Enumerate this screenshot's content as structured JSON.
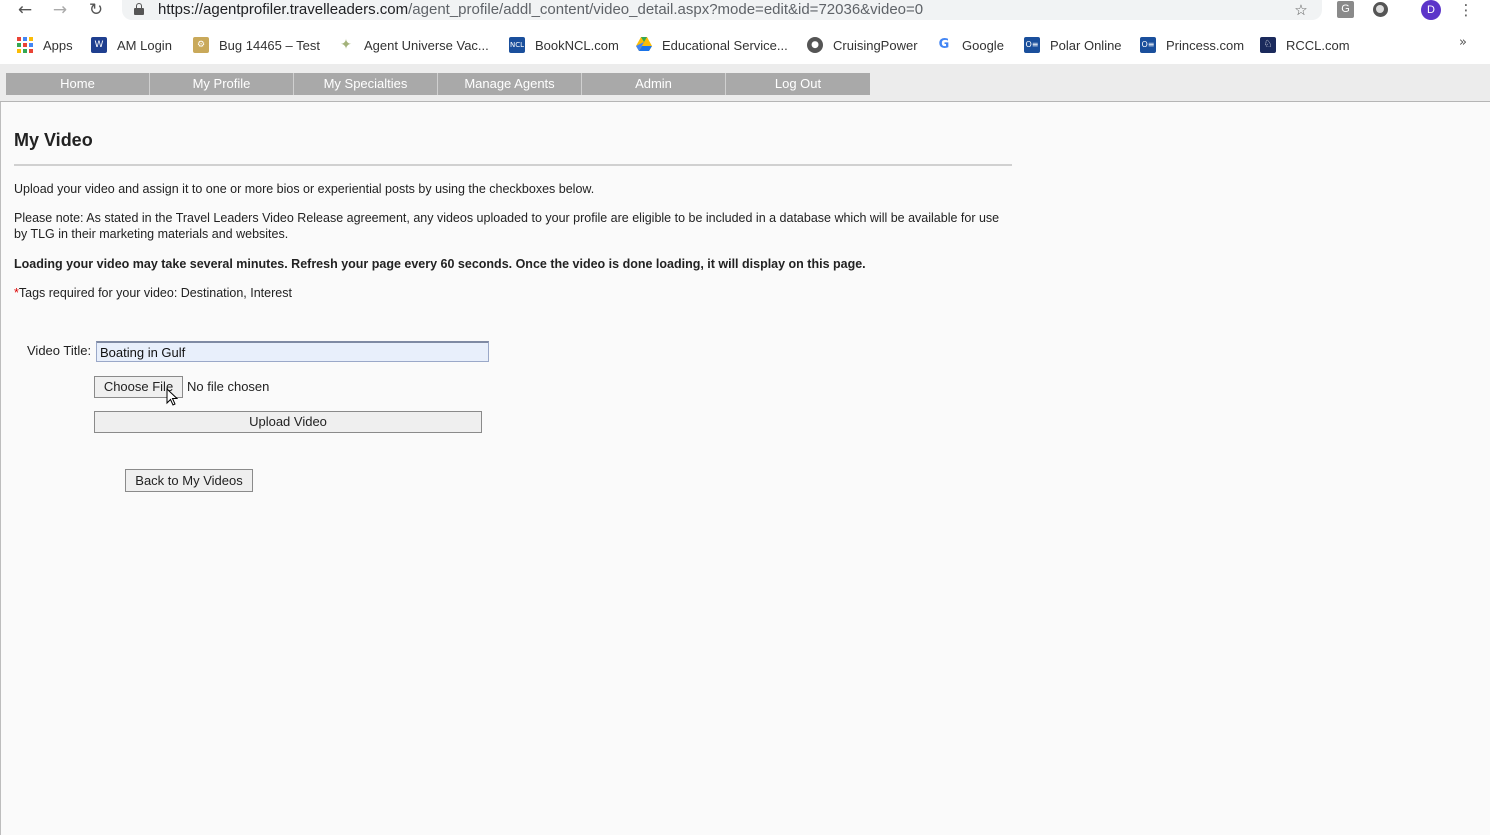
{
  "browser": {
    "url_host": "https://agentprofiler.travelleaders.com",
    "url_path": "/agent_profile/addl_content/video_detail.aspx?mode=edit&id=72036&video=0",
    "back_icon": "arrow-left-icon",
    "forward_icon": "arrow-right-icon",
    "reload_icon": "reload-icon",
    "star_icon": "star-icon",
    "ext_g_label": "G",
    "avatar_initial": "D",
    "menu_icon": "kebab-icon"
  },
  "bookmarks": {
    "items": [
      {
        "label": "Apps",
        "icon": "apps-grid-icon"
      },
      {
        "label": "AM Login",
        "icon": "am-login-icon",
        "color": "#1f3f8f"
      },
      {
        "label": "Bug 14465 – Test",
        "icon": "bug-icon",
        "color": "#c9a95a"
      },
      {
        "label": "Agent Universe Vac...",
        "icon": "sparkle-icon",
        "color": "#a3b27a"
      },
      {
        "label": "BookNCL.com",
        "icon": "ncl-icon",
        "color": "#1a4f9c"
      },
      {
        "label": "Educational Service...",
        "icon": "drive-icon"
      },
      {
        "label": "CruisingPower",
        "icon": "globe-icon",
        "color": "#555555"
      },
      {
        "label": "Google",
        "icon": "google-icon"
      },
      {
        "label": "Polar Online",
        "icon": "polar-icon",
        "color": "#1a4f9c"
      },
      {
        "label": "Princess.com",
        "icon": "princess-icon",
        "color": "#1a4f9c"
      },
      {
        "label": "RCCL.com",
        "icon": "rccl-icon",
        "color": "#1b2a5c"
      }
    ],
    "more": "»"
  },
  "nav": {
    "items": [
      "Home",
      "My Profile",
      "My Specialties",
      "Manage Agents",
      "Admin",
      "Log Out"
    ]
  },
  "page": {
    "title": "My Video",
    "intro": "Upload your video and assign it to one or more bios or experiential posts by using the checkboxes below.",
    "note": "Please note: As stated in the Travel Leaders Video Release agreement, any videos uploaded to your profile are eligible to be included in a database which will be available for use by TLG in their marketing materials and websites.",
    "loading": "Loading your video may take several minutes. Refresh your page every 60 seconds. Once the video is done loading, it will display on this page.",
    "tags_star": "*",
    "tags": "Tags required for your video: Destination, Interest"
  },
  "form": {
    "title_label": "Video Title:",
    "title_value": "Boating in Gulf",
    "choose_file_label": "Choose File",
    "file_status": "No file chosen",
    "upload_label": "Upload Video",
    "back_label": "Back to My Videos"
  }
}
